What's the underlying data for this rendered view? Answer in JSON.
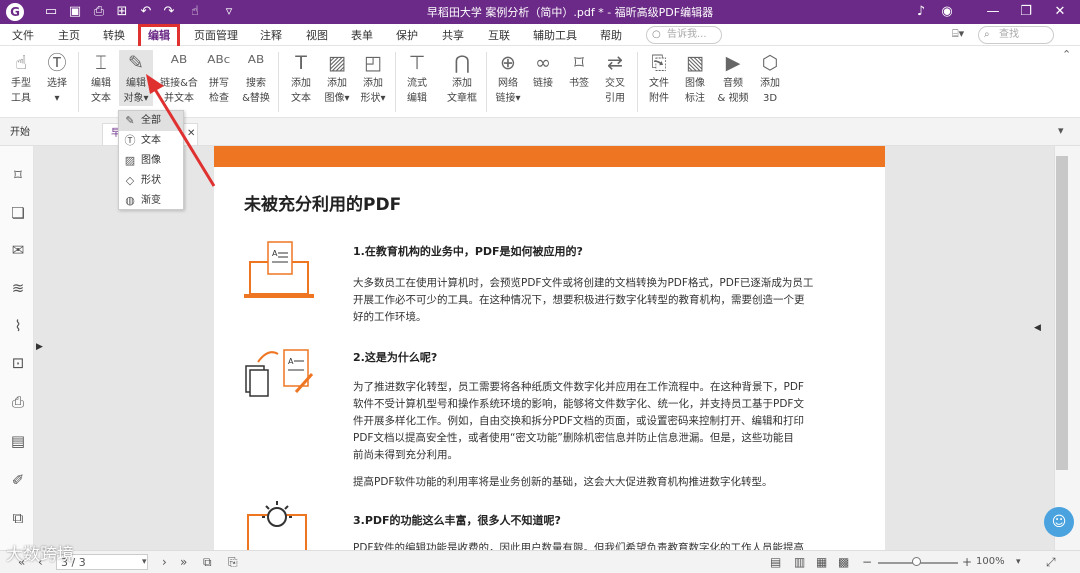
{
  "titlebar": {
    "title": "早稻田大学 案例分析（简中）.pdf * - 福昕高级PDF编辑器",
    "logo": "G",
    "tools": [
      "folder-icon",
      "save-icon",
      "print-icon",
      "new-icon",
      "undo-icon",
      "redo-icon",
      "hand-icon",
      "dropdown-icon"
    ],
    "right": [
      "bell-icon",
      "account-icon",
      "minimize-icon",
      "restore-icon",
      "close-icon"
    ]
  },
  "menu": {
    "items": [
      "文件",
      "主页",
      "转换",
      "编辑",
      "页面管理",
      "注释",
      "视图",
      "表单",
      "保护",
      "共享",
      "互联",
      "辅助工具",
      "帮助"
    ],
    "tell_me": "告诉我...",
    "find": "查找"
  },
  "ribbon": {
    "tools": [
      {
        "l1": "手型",
        "l2": "工具"
      },
      {
        "l1": "选择",
        "l2": ""
      },
      {
        "l1": "编辑",
        "l2": "文本"
      },
      {
        "l1": "编辑",
        "l2": "对象▾"
      },
      {
        "l1": "链接&合",
        "l2": "并文本"
      },
      {
        "l1": "拼写",
        "l2": "检查"
      },
      {
        "l1": "搜索",
        "l2": "&替换"
      },
      {
        "l1": "添加",
        "l2": "文本"
      },
      {
        "l1": "添加",
        "l2": "图像▾"
      },
      {
        "l1": "添加",
        "l2": "形状▾"
      },
      {
        "l1": "流式",
        "l2": "编辑"
      },
      {
        "l1": "添加",
        "l2": "文章框"
      },
      {
        "l1": "网络",
        "l2": "链接▾"
      },
      {
        "l1": "链接",
        "l2": ""
      },
      {
        "l1": "书签",
        "l2": ""
      },
      {
        "l1": "交叉",
        "l2": "引用"
      },
      {
        "l1": "文件",
        "l2": "附件"
      },
      {
        "l1": "图像",
        "l2": "标注"
      },
      {
        "l1": "音频",
        "l2": "& 视频"
      },
      {
        "l1": "添加",
        "l2": "3D"
      }
    ]
  },
  "tabs": {
    "start": "开始",
    "doc": "早"
  },
  "dropdown": [
    "全部",
    "文本",
    "图像",
    "形状",
    "渐变"
  ],
  "doc": {
    "heading": "未被充分利用的PDF",
    "s1": "1.在教育机构的业务中，PDF是如何被应用的?",
    "p1": [
      "大多数员工在使用计算机时，会预览PDF文件或将创建的文档转换为PDF格式，PDF已逐渐成为员工",
      "开展工作必不可少的工具。在这种情况下，想要积极进行数字化转型的教育机构，需要创造一个更",
      "好的工作环境。"
    ],
    "s2": "2.这是为什么呢?",
    "p2": [
      "为了推进数字化转型，员工需要将各种纸质文件数字化并应用在工作流程中。在这种背景下，PDF",
      "软件不受计算机型号和操作系统环境的影响，能够将文件数字化、统一化，并支持员工基于PDF文",
      "件开展多样化工作。例如，自由交换和拆分PDF文档的页面，或设置密码来控制打开、编辑和打印",
      "PDF文档以提高安全性，或者使用“密文功能”删除机密信息并防止信息泄漏。但是，这些功能目",
      "前尚未得到充分利用。"
    ],
    "p3": "提高PDF软件功能的利用率将是业务创新的基础，这会大大促进教育机构推进数字化转型。",
    "s3": "3.PDF的功能这么丰富，很多人不知道呢?",
    "p4": "PDF软件的编辑功能是收费的，因此用户数量有限。但我们希望负责教育数字化的工作人员能提高"
  },
  "status": {
    "page": "3 / 3",
    "zoom": "100%"
  },
  "watermark": "大数跨境",
  "colors": {
    "brand": "#6b2a87",
    "accent": "#ee7623",
    "highlight": "#e03131"
  }
}
